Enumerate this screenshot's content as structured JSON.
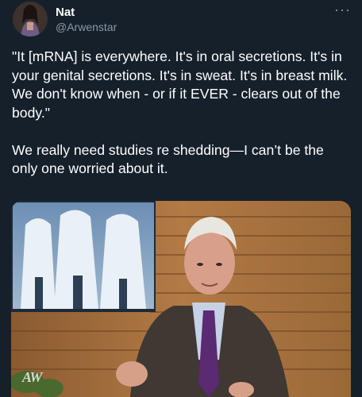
{
  "author": {
    "name": "Nat",
    "handle": "@Arwenstar"
  },
  "menu": {
    "icon": "more-horizontal-icon",
    "label": "···"
  },
  "tweet": {
    "quote": "\"It [mRNA] is everywhere. It's in oral secretions. It's in your genital secretions. It's in sweat. It's in breast milk. We don't know when - or if it EVER - clears out of the body.\"",
    "comment": "We really need studies re shedding—I can’t be the only one worried about it."
  },
  "media": {
    "description_icon": "video-still",
    "watermark": "AW"
  },
  "colors": {
    "background": "#15202b",
    "secondary_text": "#8b98a5",
    "primary_text": "#ffffff"
  }
}
